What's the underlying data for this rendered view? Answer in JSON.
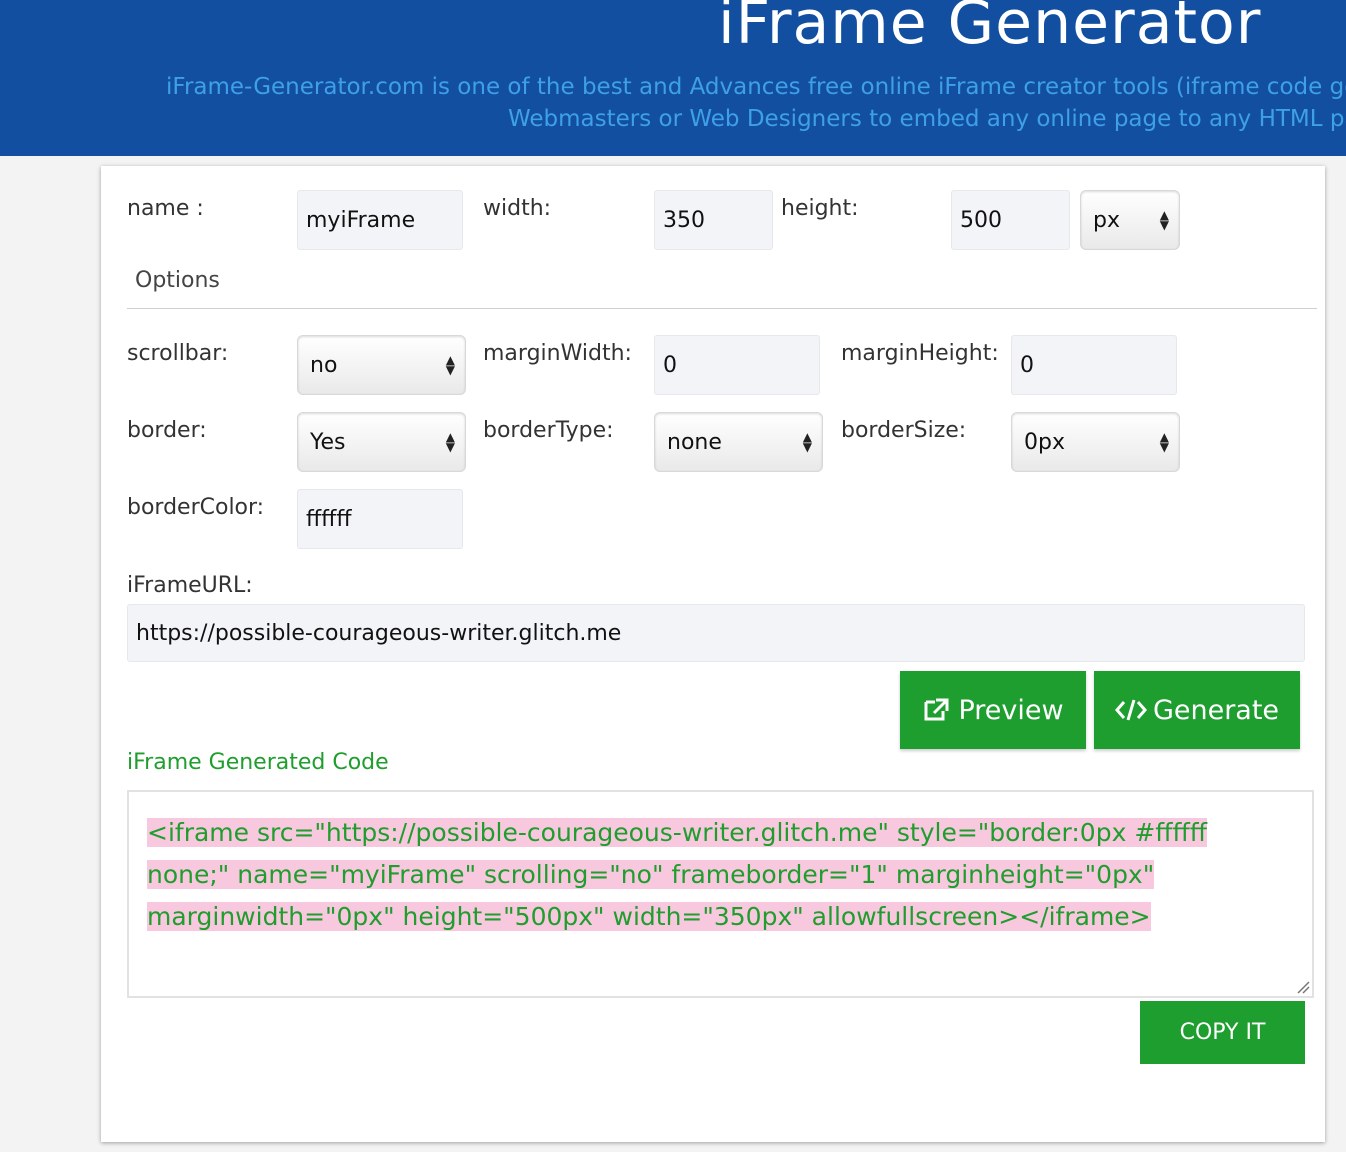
{
  "header": {
    "title": "iFrame Generator",
    "subtitle_line1": "iFrame-Generator.com is one of the best and Advances free online iFrame creator tools (iframe code gene",
    "subtitle_line2": "Webmasters or Web Designers to embed any online page to any HTML pag"
  },
  "form": {
    "name_label": "name :",
    "name_value": "myiFrame",
    "width_label": "width:",
    "width_value": "350",
    "height_label": "height:",
    "height_value": "500",
    "unit_value": "px",
    "options_title": "Options",
    "scrollbar_label": "scrollbar:",
    "scrollbar_value": "no",
    "marginwidth_label": "marginWidth:",
    "marginwidth_value": "0",
    "marginheight_label": "marginHeight:",
    "marginheight_value": "0",
    "border_label": "border:",
    "border_value": "Yes",
    "bordertype_label": "borderType:",
    "bordertype_value": "none",
    "bordersize_label": "borderSize:",
    "bordersize_value": "0px",
    "bordercolor_label": "borderColor:",
    "bordercolor_value": "ffffff",
    "url_label": "iFrameURL:",
    "url_value": "https://possible-courageous-writer.glitch.me"
  },
  "actions": {
    "preview_label": "Preview",
    "generate_label": "Generate",
    "copy_label": "COPY IT"
  },
  "output": {
    "title": "iFrame Generated Code",
    "code_line1": "<iframe src=\"https://possible-courageous-writer.glitch.me\" style=\"border:0px #ffffff",
    "code_line2": "none;\" name=\"myiFrame\" scrolling=\"no\" frameborder=\"1\" marginheight=\"0px\"",
    "code_line3": "marginwidth=\"0px\" height=\"500px\" width=\"350px\" allowfullscreen></iframe>"
  },
  "colors": {
    "header_bg": "#134fa0",
    "subtitle": "#3ea0e6",
    "accent_green": "#1d9e2e",
    "code_highlight": "#f8c8de"
  },
  "icons": [
    "external-link-icon",
    "code-icon",
    "select-arrows-icon",
    "resize-handle-icon"
  ]
}
